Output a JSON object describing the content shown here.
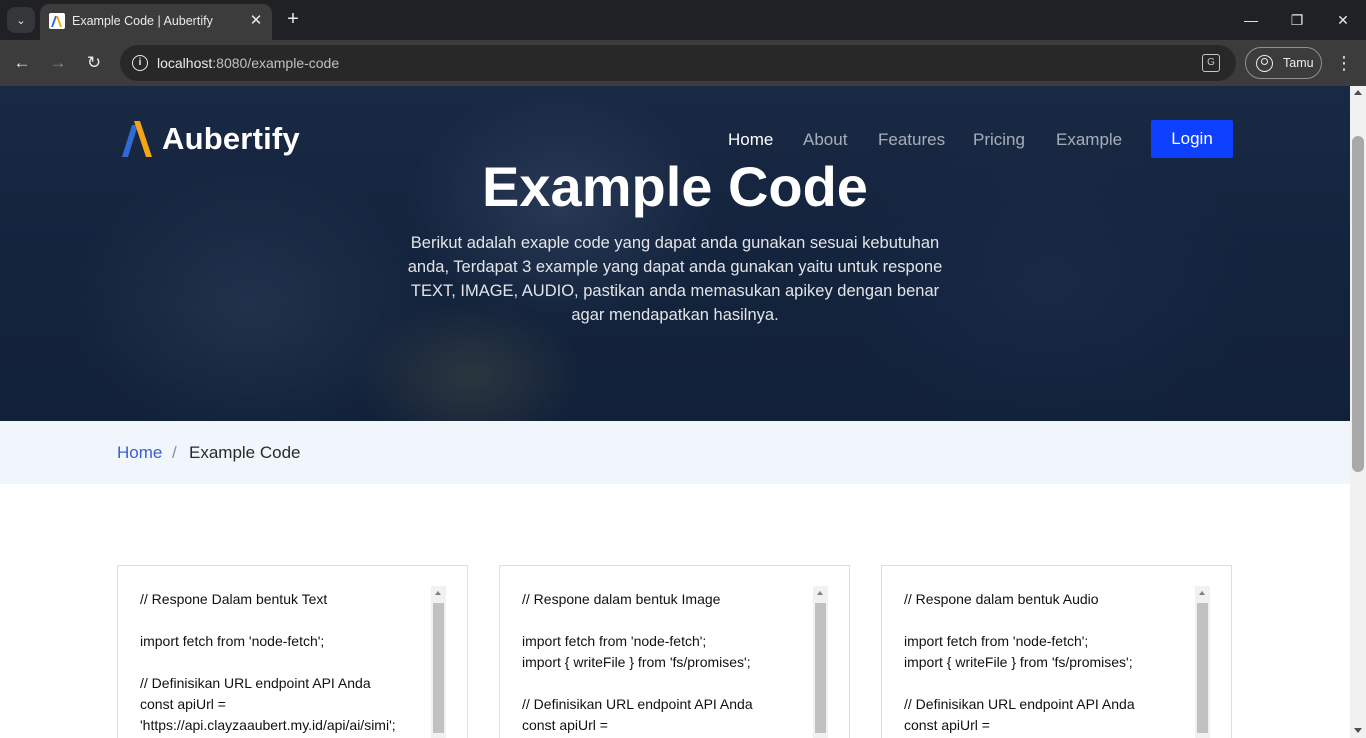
{
  "browser": {
    "tab_title": "Example Code | Aubertify",
    "url_host": "localhost",
    "url_rest": ":8080/example-code",
    "profile_label": "Tamu",
    "icons": [
      "tab-list-icon",
      "close-icon",
      "plus-icon",
      "minimize-icon",
      "restore-icon",
      "close-window-icon",
      "back-icon",
      "forward-icon",
      "reload-icon",
      "info-icon",
      "translate-icon",
      "profile-icon",
      "kebab-menu-icon"
    ]
  },
  "site": {
    "brand": "Aubertify",
    "nav": {
      "home": "Home",
      "about": "About",
      "features": "Features",
      "pricing": "Pricing",
      "example": "Example",
      "login": "Login"
    },
    "hero": {
      "title": "Example Code",
      "description": "Berikut adalah exaple code yang dapat anda gunakan sesuai kebutuhan anda, Terdapat 3 example yang dapat anda gunakan yaitu untuk respone TEXT, IMAGE, AUDIO, pastikan anda memasukan apikey dengan benar agar mendapatkan hasilnya."
    },
    "breadcrumb": {
      "home": "Home",
      "separator": "/",
      "current": "Example Code"
    },
    "cards": [
      {
        "code": "// Respone Dalam bentuk Text\n\nimport fetch from 'node-fetch';\n\n// Definisikan URL endpoint API Anda\nconst apiUrl =\n'https://api.clayzaaubert.my.id/api/ai/simi';"
      },
      {
        "code": "// Respone dalam bentuk Image\n\nimport fetch from 'node-fetch';\nimport { writeFile } from 'fs/promises';\n\n// Definisikan URL endpoint API Anda\nconst apiUrl ="
      },
      {
        "code": "// Respone dalam bentuk Audio\n\nimport fetch from 'node-fetch';\nimport { writeFile } from 'fs/promises';\n\n// Definisikan URL endpoint API Anda\nconst apiUrl ="
      }
    ],
    "colors": {
      "login_button": "#0d40ff",
      "breadcrumb_bg": "#f0f6fc",
      "breadcrumb_link": "#3a5fd0",
      "logo_blue": "#2f6bd6",
      "logo_orange": "#f2a516"
    }
  }
}
